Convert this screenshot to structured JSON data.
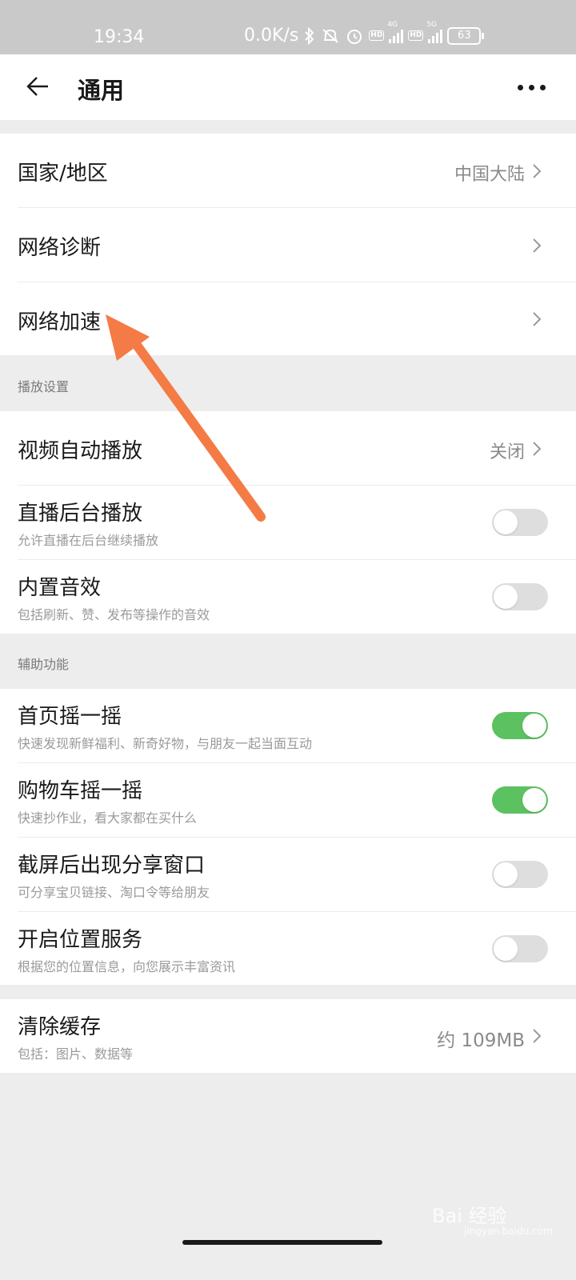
{
  "status_bar": {
    "time": "19:34",
    "net_speed": "0.0K/s",
    "icons": [
      "bluetooth-icon",
      "mute-icon",
      "alarm-icon",
      "hd-icon",
      "signal-4g-icon",
      "hd-icon",
      "signal-5g-icon",
      "battery-icon"
    ],
    "hd_label": "HD",
    "net_4g": "4G",
    "net_5g": "5G",
    "battery": "63"
  },
  "nav": {
    "title": "通用",
    "back_icon": "arrow-left-icon",
    "more_icon": "more-dots-icon"
  },
  "group1": {
    "items": [
      {
        "title": "国家/地区",
        "value": "中国大陆"
      },
      {
        "title": "网络诊断",
        "value": ""
      },
      {
        "title": "网络加速",
        "value": ""
      }
    ]
  },
  "section_play": {
    "label": "播放设置",
    "video_autoplay": {
      "title": "视频自动播放",
      "value": "关闭"
    },
    "live_bg": {
      "title": "直播后台播放",
      "subtitle": "允许直播在后台继续播放",
      "on": false
    },
    "sound": {
      "title": "内置音效",
      "subtitle": "包括刷新、赞、发布等操作的音效",
      "on": false
    }
  },
  "section_assist": {
    "label": "辅助功能",
    "items": [
      {
        "title": "首页摇一摇",
        "subtitle": "快速发现新鲜福利、新奇好物，与朋友一起当面互动",
        "on": true
      },
      {
        "title": "购物车摇一摇",
        "subtitle": "快速抄作业，看大家都在买什么",
        "on": true
      },
      {
        "title": "截屏后出现分享窗口",
        "subtitle": "可分享宝贝链接、淘口令等给朋友",
        "on": false
      },
      {
        "title": "开启位置服务",
        "subtitle": "根据您的位置信息，向您展示丰富资讯",
        "on": false
      }
    ]
  },
  "cache": {
    "title": "清除缓存",
    "subtitle": "包括：图片、数据等",
    "value": "约 109MB"
  },
  "annotation": {
    "arrow_color": "#f47b45"
  },
  "watermark": {
    "text": "Bai 经验",
    "sub": "jingyan.baidu.com"
  },
  "colors": {
    "toggle_on": "#5cc160",
    "toggle_off": "#dedede",
    "background": "#ededed"
  }
}
